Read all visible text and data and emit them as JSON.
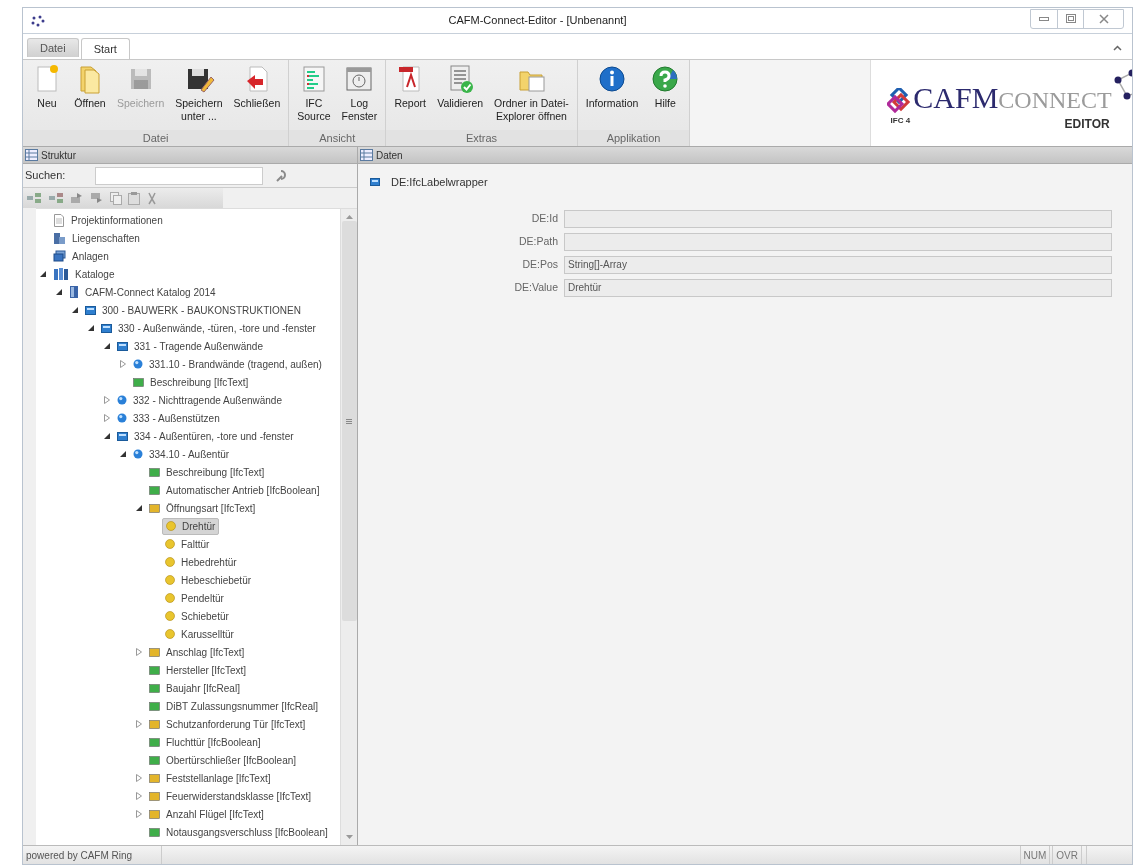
{
  "window": {
    "title": "CAFM-Connect-Editor - [Unbenannt]"
  },
  "ribbon_tabs": [
    {
      "label": "Datei",
      "selected": false
    },
    {
      "label": "Start",
      "selected": true
    }
  ],
  "ribbon_groups": [
    {
      "label": "Datei",
      "buttons": [
        {
          "kind": "new",
          "label": "Neu",
          "disabled": false
        },
        {
          "kind": "open",
          "label": "Öffnen",
          "disabled": false
        },
        {
          "kind": "save",
          "label": "Speichern",
          "disabled": true
        },
        {
          "kind": "save-as",
          "label": "Speichern\nunter ...",
          "disabled": false
        },
        {
          "kind": "close",
          "label": "Schließen",
          "disabled": false
        }
      ]
    },
    {
      "label": "Ansicht",
      "buttons": [
        {
          "kind": "source",
          "label": "IFC\nSource",
          "disabled": false
        },
        {
          "kind": "log",
          "label": "Log\nFenster",
          "disabled": false
        }
      ]
    },
    {
      "label": "Extras",
      "buttons": [
        {
          "kind": "pdf",
          "label": "Report",
          "disabled": false
        },
        {
          "kind": "validate",
          "label": "Validieren",
          "disabled": false
        },
        {
          "kind": "folder",
          "label": "Ordner in Datei-\nExplorer öffnen",
          "disabled": false
        }
      ]
    },
    {
      "label": "Applikation",
      "buttons": [
        {
          "kind": "info",
          "label": "Information",
          "disabled": false
        },
        {
          "kind": "help",
          "label": "Hilfe",
          "disabled": false
        }
      ]
    }
  ],
  "logo": {
    "badge": "IFC 4",
    "brand_bold": "CAFM",
    "brand_light": "CONNECT",
    "subtitle": "EDITOR"
  },
  "structure_panel": {
    "title": "Struktur",
    "search": {
      "label": "Suchen:"
    },
    "tree": [
      {
        "label": "Projektinformationen",
        "kind": "document",
        "selected": false
      },
      {
        "label": "Liegenschaften",
        "kind": "building",
        "selected": false
      },
      {
        "label": "Anlagen",
        "kind": "stack",
        "selected": false
      },
      {
        "label": "Kataloge",
        "kind": "catalog",
        "selected": false,
        "expanded": true,
        "children": [
          {
            "label": "CAFM-Connect Katalog 2014",
            "kind": "book",
            "selected": false,
            "expanded": true,
            "children": [
              {
                "label": "300 - BAUWERK - BAUKONSTRUKTIONEN",
                "kind": "category",
                "selected": false,
                "expanded": true,
                "children": [
                  {
                    "label": "330 - Außenwände, -türen, -tore und -fenster",
                    "kind": "category",
                    "selected": false,
                    "expanded": true,
                    "children": [
                      {
                        "label": "331 - Tragende Außenwände",
                        "kind": "category",
                        "selected": false,
                        "expanded": true,
                        "children": [
                          {
                            "label": "331.10 - Brandwände (tragend, außen)",
                            "kind": "class",
                            "selected": false,
                            "expanded": false
                          },
                          {
                            "label": "Beschreibung [IfcText]",
                            "kind": "property",
                            "color": "#3fae49",
                            "selected": false
                          }
                        ]
                      },
                      {
                        "label": "332 - Nichttragende Außenwände",
                        "kind": "class",
                        "selected": false,
                        "expanded": false
                      },
                      {
                        "label": "333 - Außenstützen",
                        "kind": "class",
                        "selected": false,
                        "expanded": false
                      },
                      {
                        "label": "334 - Außentüren, -tore und -fenster",
                        "kind": "category",
                        "selected": false,
                        "expanded": true,
                        "children": [
                          {
                            "label": "334.10 - Außentür",
                            "kind": "class",
                            "selected": false,
                            "expanded": true,
                            "children": [
                              {
                                "label": "Beschreibung [IfcText]",
                                "kind": "property",
                                "color": "#3fae49",
                                "selected": false
                              },
                              {
                                "label": "Automatischer Antrieb [IfcBoolean]",
                                "kind": "property",
                                "color": "#3fae49",
                                "selected": false
                              },
                              {
                                "label": "Öffnungsart [IfcText]",
                                "kind": "property",
                                "color": "#e3b52a",
                                "selected": false,
                                "expanded": true,
                                "children": [
                                  {
                                    "label": "Drehtür",
                                    "kind": "option",
                                    "selected": true
                                  },
                                  {
                                    "label": "Falttür",
                                    "kind": "option",
                                    "selected": false
                                  },
                                  {
                                    "label": "Hebedrehtür",
                                    "kind": "option",
                                    "selected": false
                                  },
                                  {
                                    "label": "Hebeschiebetür",
                                    "kind": "option",
                                    "selected": false
                                  },
                                  {
                                    "label": "Pendeltür",
                                    "kind": "option",
                                    "selected": false
                                  },
                                  {
                                    "label": "Schiebetür",
                                    "kind": "option",
                                    "selected": false
                                  },
                                  {
                                    "label": "Karusselltür",
                                    "kind": "option",
                                    "selected": false
                                  }
                                ]
                              },
                              {
                                "label": "Anschlag [IfcText]",
                                "kind": "property",
                                "color": "#e3b52a",
                                "selected": false,
                                "expanded": false
                              },
                              {
                                "label": "Hersteller [IfcText]",
                                "kind": "property",
                                "color": "#3fae49",
                                "selected": false
                              },
                              {
                                "label": "Baujahr [IfcReal]",
                                "kind": "property",
                                "color": "#3fae49",
                                "selected": false
                              },
                              {
                                "label": "DiBT Zulassungsnummer [IfcReal]",
                                "kind": "property",
                                "color": "#3fae49",
                                "selected": false
                              },
                              {
                                "label": "Schutzanforderung Tür [IfcText]",
                                "kind": "property",
                                "color": "#e3b52a",
                                "selected": false,
                                "expanded": false
                              },
                              {
                                "label": "Fluchttür [IfcBoolean]",
                                "kind": "property",
                                "color": "#3fae49",
                                "selected": false
                              },
                              {
                                "label": "Obertürschließer [IfcBoolean]",
                                "kind": "property",
                                "color": "#3fae49",
                                "selected": false
                              },
                              {
                                "label": "Feststellanlage [IfcText]",
                                "kind": "property",
                                "color": "#e3b52a",
                                "selected": false,
                                "expanded": false
                              },
                              {
                                "label": "Feuerwiderstandsklasse [IfcText]",
                                "kind": "property",
                                "color": "#e3b52a",
                                "selected": false,
                                "expanded": false
                              },
                              {
                                "label": "Anzahl Flügel [IfcText]",
                                "kind": "property",
                                "color": "#e3b52a",
                                "selected": false,
                                "expanded": false
                              },
                              {
                                "label": "Notausgangsverschluss [IfcBoolean]",
                                "kind": "property",
                                "color": "#3fae49",
                                "selected": false
                              }
                            ]
                          }
                        ]
                      }
                    ]
                  }
                ]
              }
            ]
          }
        ]
      }
    ]
  },
  "data_panel": {
    "title": "Daten",
    "object": "DE:IfcLabelwrapper",
    "fields": [
      {
        "label": "DE:Id"
      },
      {
        "label": "DE:Path"
      },
      {
        "label": "DE:Pos",
        "value": "String[]-Array"
      },
      {
        "label": "DE:Value",
        "value": "Drehtür"
      }
    ]
  },
  "status_bar": {
    "text": "powered by CAFM Ring",
    "indicators": [
      "NUM",
      "OVR"
    ]
  }
}
